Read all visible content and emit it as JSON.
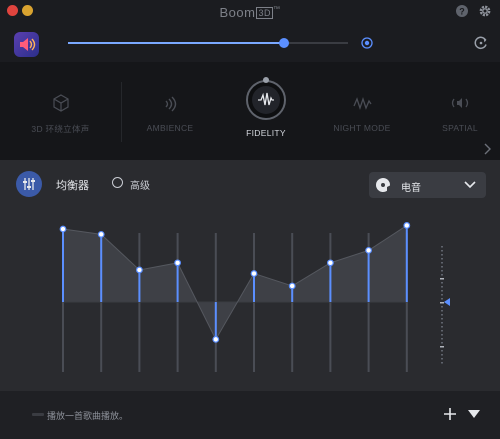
{
  "window": {
    "title": "Boom",
    "title_badge": "3D",
    "title_tm": "™"
  },
  "volume": {
    "level": 0.77
  },
  "modes": [
    {
      "label": "3D 环绕立体声",
      "icon": "cube-icon",
      "active": false
    },
    {
      "label": "AMBIENCE",
      "icon": "ambience-waves-icon",
      "active": false
    },
    {
      "label": "FIDELITY",
      "icon": "fidelity-waveform-icon",
      "active": true
    },
    {
      "label": "NIGHT MODE",
      "icon": "night-mode-wave-icon",
      "active": false
    },
    {
      "label": "SPATIAL",
      "icon": "spatial-speaker-icon",
      "active": false
    }
  ],
  "equalizer": {
    "title": "均衡器",
    "advanced_label": "高级",
    "advanced_selected": false,
    "preset_label": "电音",
    "band_levels": [
      0.82,
      0.76,
      0.36,
      0.44,
      -0.42,
      0.32,
      0.18,
      0.44,
      0.58,
      0.86
    ],
    "preamp_level": 0.0,
    "accent_color": "#5b8fff"
  },
  "player": {
    "track_text": "播放一首歌曲播放。"
  }
}
